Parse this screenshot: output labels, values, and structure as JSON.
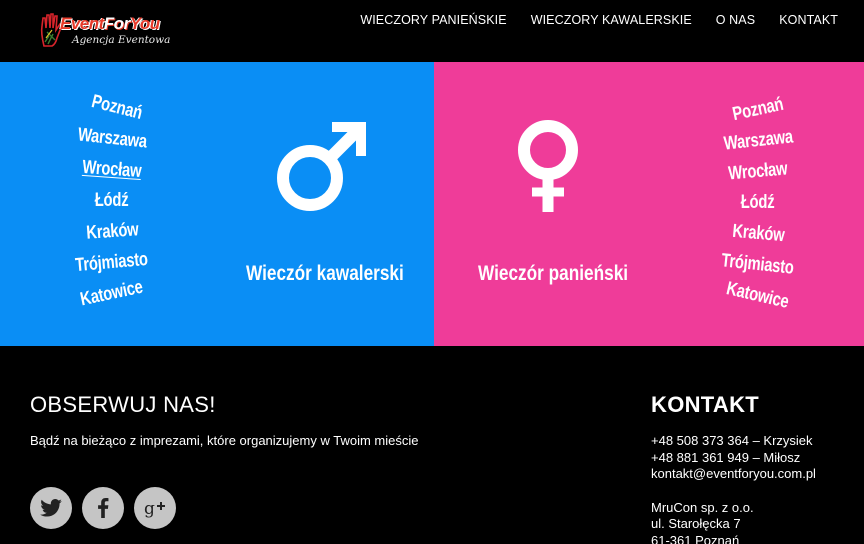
{
  "header": {
    "logo": {
      "name_part1": "Event",
      "name_part2": "For",
      "name_part3": "You",
      "tagline": "Agencja Eventowa"
    },
    "nav": [
      {
        "label": "WIECZORY PANIEŃSKIE"
      },
      {
        "label": "WIECZORY KAWALERSKIE"
      },
      {
        "label": "O NAS"
      },
      {
        "label": "KONTAKT"
      }
    ]
  },
  "panels": {
    "bachelor": {
      "title": "Wieczór kawalerski",
      "icon": "male-symbol-icon",
      "background": "#0a8ef5",
      "cities": [
        "Poznań",
        "Warszawa",
        "Wrocław",
        "Łódź",
        "Kraków",
        "Trójmiasto",
        "Katowice"
      ],
      "active_city": "Wrocław"
    },
    "bachelorette": {
      "title": "Wieczór panieński",
      "icon": "female-symbol-icon",
      "background": "#ef3c99",
      "cities": [
        "Poznań",
        "Warszawa",
        "Wrocław",
        "Łódź",
        "Kraków",
        "Trójmiasto",
        "Katowice"
      ]
    }
  },
  "footer": {
    "follow_title": "OBSERWUJ NAS!",
    "follow_text": "Bądź na bieżąco z imprezami, które organizujemy w Twoim mieście",
    "socials": [
      {
        "icon": "twitter-icon"
      },
      {
        "icon": "facebook-icon"
      },
      {
        "icon": "google-plus-icon"
      }
    ],
    "contact_title": "KONTAKT",
    "contact": {
      "phone1": "+48 508 373 364 – Krzysiek",
      "phone2": "+48 881 361 949 – Miłosz",
      "email": "kontakt@eventforyou.com.pl",
      "company": "MruCon sp. z o.o.",
      "street": "ul. Starołęcka 7",
      "city": "61-361 Poznań"
    }
  }
}
